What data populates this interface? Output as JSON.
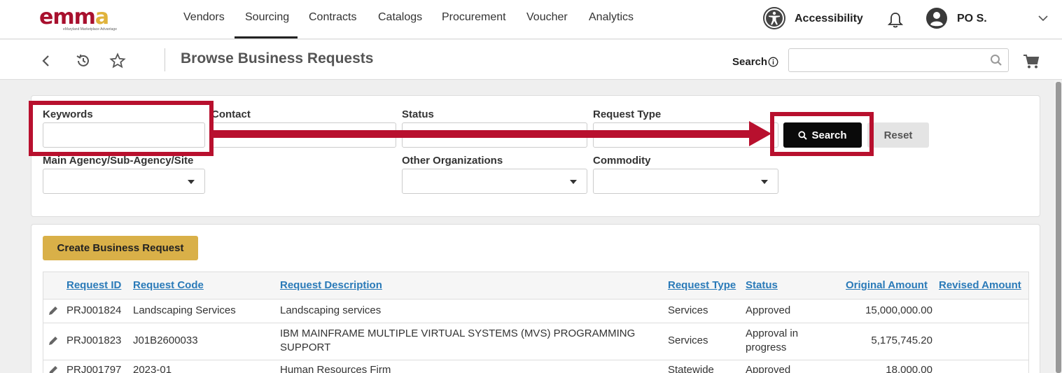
{
  "topnav": {
    "logo_text": "emma",
    "logo_tagline": "eMaryland Marketplace Advantage",
    "items": [
      {
        "label": "Vendors"
      },
      {
        "label": "Sourcing"
      },
      {
        "label": "Contracts"
      },
      {
        "label": "Catalogs"
      },
      {
        "label": "Procurement"
      },
      {
        "label": "Voucher"
      },
      {
        "label": "Analytics"
      }
    ],
    "active_item": "Sourcing",
    "accessibility_label": "Accessibility",
    "user_label": "PO S."
  },
  "subbar": {
    "title": "Browse Business Requests",
    "search_label": "Search",
    "search_value": ""
  },
  "filters": {
    "keywords_label": "Keywords",
    "contact_label": "Contact",
    "status_label": "Status",
    "request_type_label": "Request Type",
    "agency_label": "Main Agency/Sub-Agency/Site",
    "other_orgs_label": "Other Organizations",
    "commodity_label": "Commodity",
    "search_button": "Search",
    "reset_button": "Reset"
  },
  "results": {
    "create_button": "Create Business Request",
    "columns": [
      "Request ID",
      "Request Code",
      "Request Description",
      "Request Type",
      "Status",
      "Original Amount",
      "Revised Amount"
    ],
    "rows": [
      {
        "id": "PRJ001824",
        "code": "Landscaping Services",
        "description": "Landscaping services",
        "type": "Services",
        "status": "Approved",
        "original": "15,000,000.00",
        "revised": ""
      },
      {
        "id": "PRJ001823",
        "code": "J01B2600033",
        "description": "IBM MAINFRAME MULTIPLE VIRTUAL SYSTEMS (MVS) PROGRAMMING SUPPORT",
        "type": "Services",
        "status": "Approval in progress",
        "original": "5,175,745.20",
        "revised": ""
      },
      {
        "id": "PRJ001797",
        "code": "2023-01",
        "description": "Human Resources Firm",
        "type": "Statewide",
        "status": "Approved",
        "original": "18,000.00",
        "revised": ""
      }
    ]
  },
  "colors": {
    "annotation_red": "#b8102e",
    "link_blue": "#2a7ab8",
    "create_button_gold": "#d9b048",
    "search_button_black": "#0a0a0a"
  },
  "icons": [
    "back-icon",
    "history-icon",
    "star-icon",
    "info-icon",
    "search-icon",
    "cart-icon",
    "accessibility-icon",
    "bell-icon",
    "user-icon",
    "chevron-down-icon",
    "pencil-icon"
  ]
}
